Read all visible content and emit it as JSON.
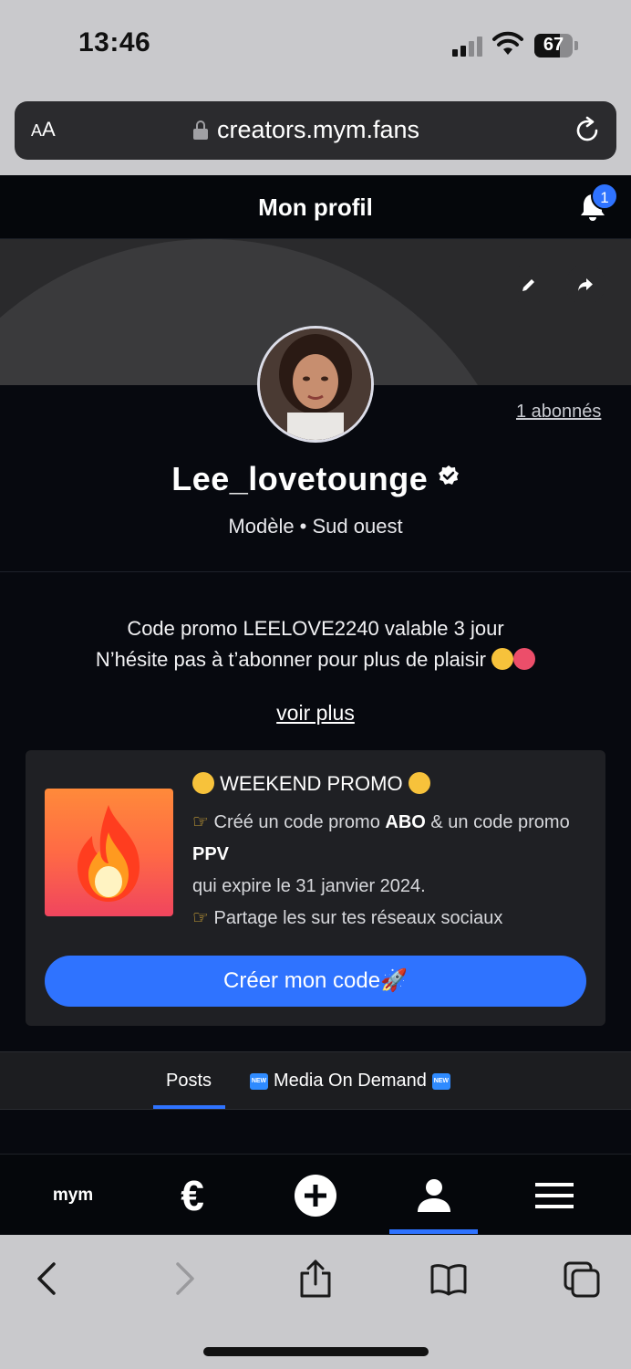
{
  "status_bar": {
    "time": "13:46",
    "battery_level": "67"
  },
  "browser": {
    "text_size_label_small": "A",
    "text_size_label_large": "A",
    "url": "creators.mym.fans"
  },
  "header": {
    "title": "Mon profil",
    "notification_count": "1"
  },
  "profile": {
    "subscribers": "1 abonnés",
    "username": "Lee_lovetounge",
    "role": "Modèle • Sud ouest",
    "bio_line1": "Code promo LEELOVE2240 valable 3 jour",
    "bio_line2": "N’hésite pas à t’abonner pour plus de plaisir",
    "see_more": "voir plus"
  },
  "promo": {
    "title": "WEEKEND PROMO",
    "line1_prefix": "Créé un code promo ",
    "line1_bold": "ABO",
    "line1_suffix": " & un code promo ",
    "line1_bold2": "PPV",
    "line2": "qui expire le 31 janvier 2024.",
    "line3": "Partage les sur tes réseaux sociaux",
    "cta": "Créer mon code"
  },
  "tabs": {
    "posts": "Posts",
    "media_on_demand": "Media On Demand",
    "new_badge": "NEW"
  },
  "bottom_nav": {
    "logo": "mym",
    "wallet_symbol": "€",
    "active": "profile"
  },
  "colors": {
    "accent": "#2f73ff",
    "background": "#07090f",
    "card": "#1f2024"
  }
}
